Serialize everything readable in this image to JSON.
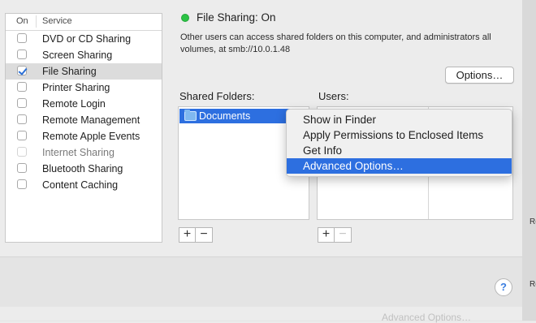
{
  "services_panel": {
    "header_on": "On",
    "header_service": "Service",
    "items": [
      {
        "label": "DVD or CD Sharing",
        "checked": false,
        "enabled": true
      },
      {
        "label": "Screen Sharing",
        "checked": false,
        "enabled": true
      },
      {
        "label": "File Sharing",
        "checked": true,
        "enabled": true,
        "selected": true
      },
      {
        "label": "Printer Sharing",
        "checked": false,
        "enabled": true
      },
      {
        "label": "Remote Login",
        "checked": false,
        "enabled": true
      },
      {
        "label": "Remote Management",
        "checked": false,
        "enabled": true
      },
      {
        "label": "Remote Apple Events",
        "checked": false,
        "enabled": true
      },
      {
        "label": "Internet Sharing",
        "checked": false,
        "enabled": false
      },
      {
        "label": "Bluetooth Sharing",
        "checked": false,
        "enabled": true
      },
      {
        "label": "Content Caching",
        "checked": false,
        "enabled": true
      }
    ]
  },
  "status": {
    "title": "File Sharing: On",
    "description": "Other users can access shared folders on this computer, and administrators all volumes, at smb://10.0.1.48",
    "indicator_color": "#2bc345"
  },
  "options_button": "Options…",
  "shared_folders": {
    "label": "Shared Folders:",
    "items": [
      "Documents"
    ]
  },
  "users": {
    "label": "Users:"
  },
  "context_menu": {
    "items": [
      "Show in Finder",
      "Apply Permissions to Enclosed Items",
      "Get Info",
      "Advanced Options…"
    ],
    "highlighted_index": 3
  },
  "buttons": {
    "add": "+",
    "remove": "−"
  },
  "help_button": "?",
  "background_window_text": "Advanced Options…",
  "colors": {
    "selection_blue": "#2d6fe0",
    "status_green": "#2bc345"
  }
}
